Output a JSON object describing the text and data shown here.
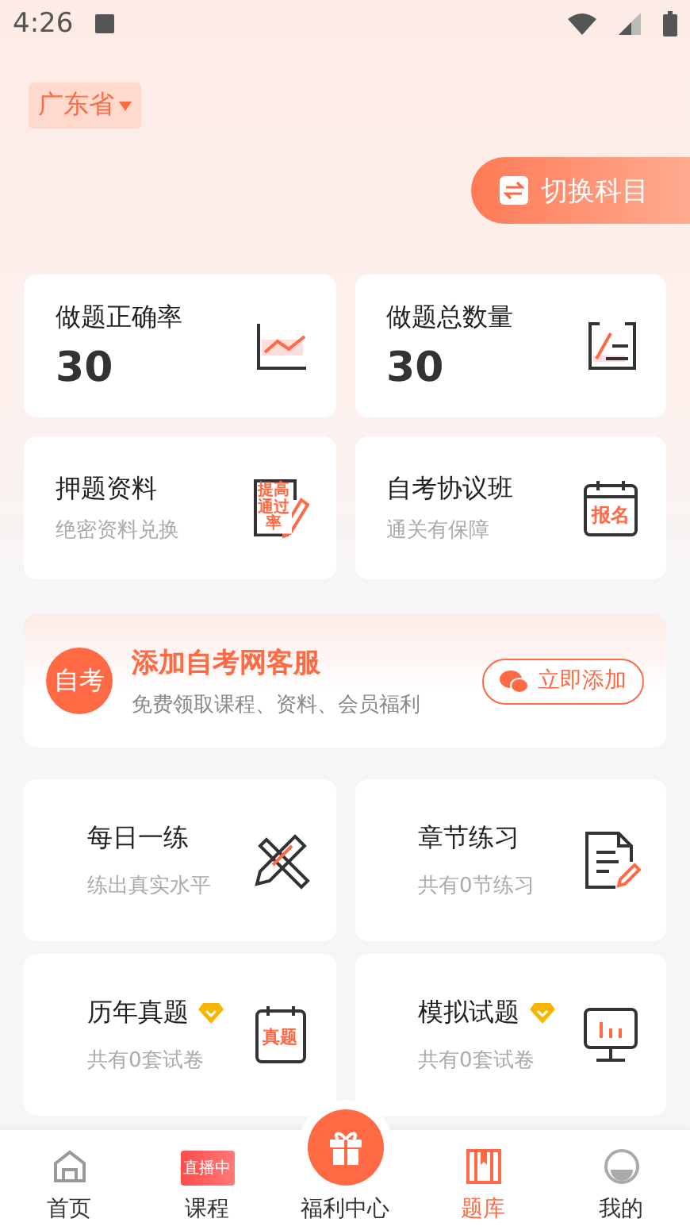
{
  "status_bar": {
    "time": "4:26"
  },
  "province": {
    "label": "广东省"
  },
  "switch_button": {
    "label": "切换科目"
  },
  "stats": [
    {
      "kind": "rate",
      "title": "做题正确率",
      "value": "30"
    },
    {
      "kind": "count",
      "title": "做题总数量",
      "value": "30"
    }
  ],
  "features": [
    {
      "kind": "material",
      "title": "押题资料",
      "subtitle": "绝密资料兑换",
      "icon_text": "提高通过率"
    },
    {
      "kind": "class",
      "title": "自考协议班",
      "subtitle": "通关有保障",
      "icon_text": "报名"
    }
  ],
  "banner": {
    "logo_text": "自考",
    "title": "添加自考网客服",
    "subtitle": "免费领取课程、资料、会员福利",
    "button": "立即添加"
  },
  "practice": [
    {
      "kind": "daily",
      "title": "每日一练",
      "subtitle": "练出真实水平",
      "vip": false
    },
    {
      "kind": "chapter",
      "title": "章节练习",
      "subtitle": "共有0节练习",
      "vip": false
    },
    {
      "kind": "past",
      "title": "历年真题",
      "subtitle": "共有0套试卷",
      "vip": true,
      "icon_text": "真题"
    },
    {
      "kind": "mock",
      "title": "模拟试题",
      "subtitle": "共有0套试卷",
      "vip": true
    }
  ],
  "nav": [
    {
      "kind": "home",
      "label": "首页",
      "selected": false
    },
    {
      "kind": "course",
      "label": "课程",
      "selected": false,
      "icon_text": "直播中"
    },
    {
      "kind": "gift",
      "label": "福利中心",
      "selected": false
    },
    {
      "kind": "bank",
      "label": "题库",
      "selected": true
    },
    {
      "kind": "me",
      "label": "我的",
      "selected": false
    }
  ]
}
